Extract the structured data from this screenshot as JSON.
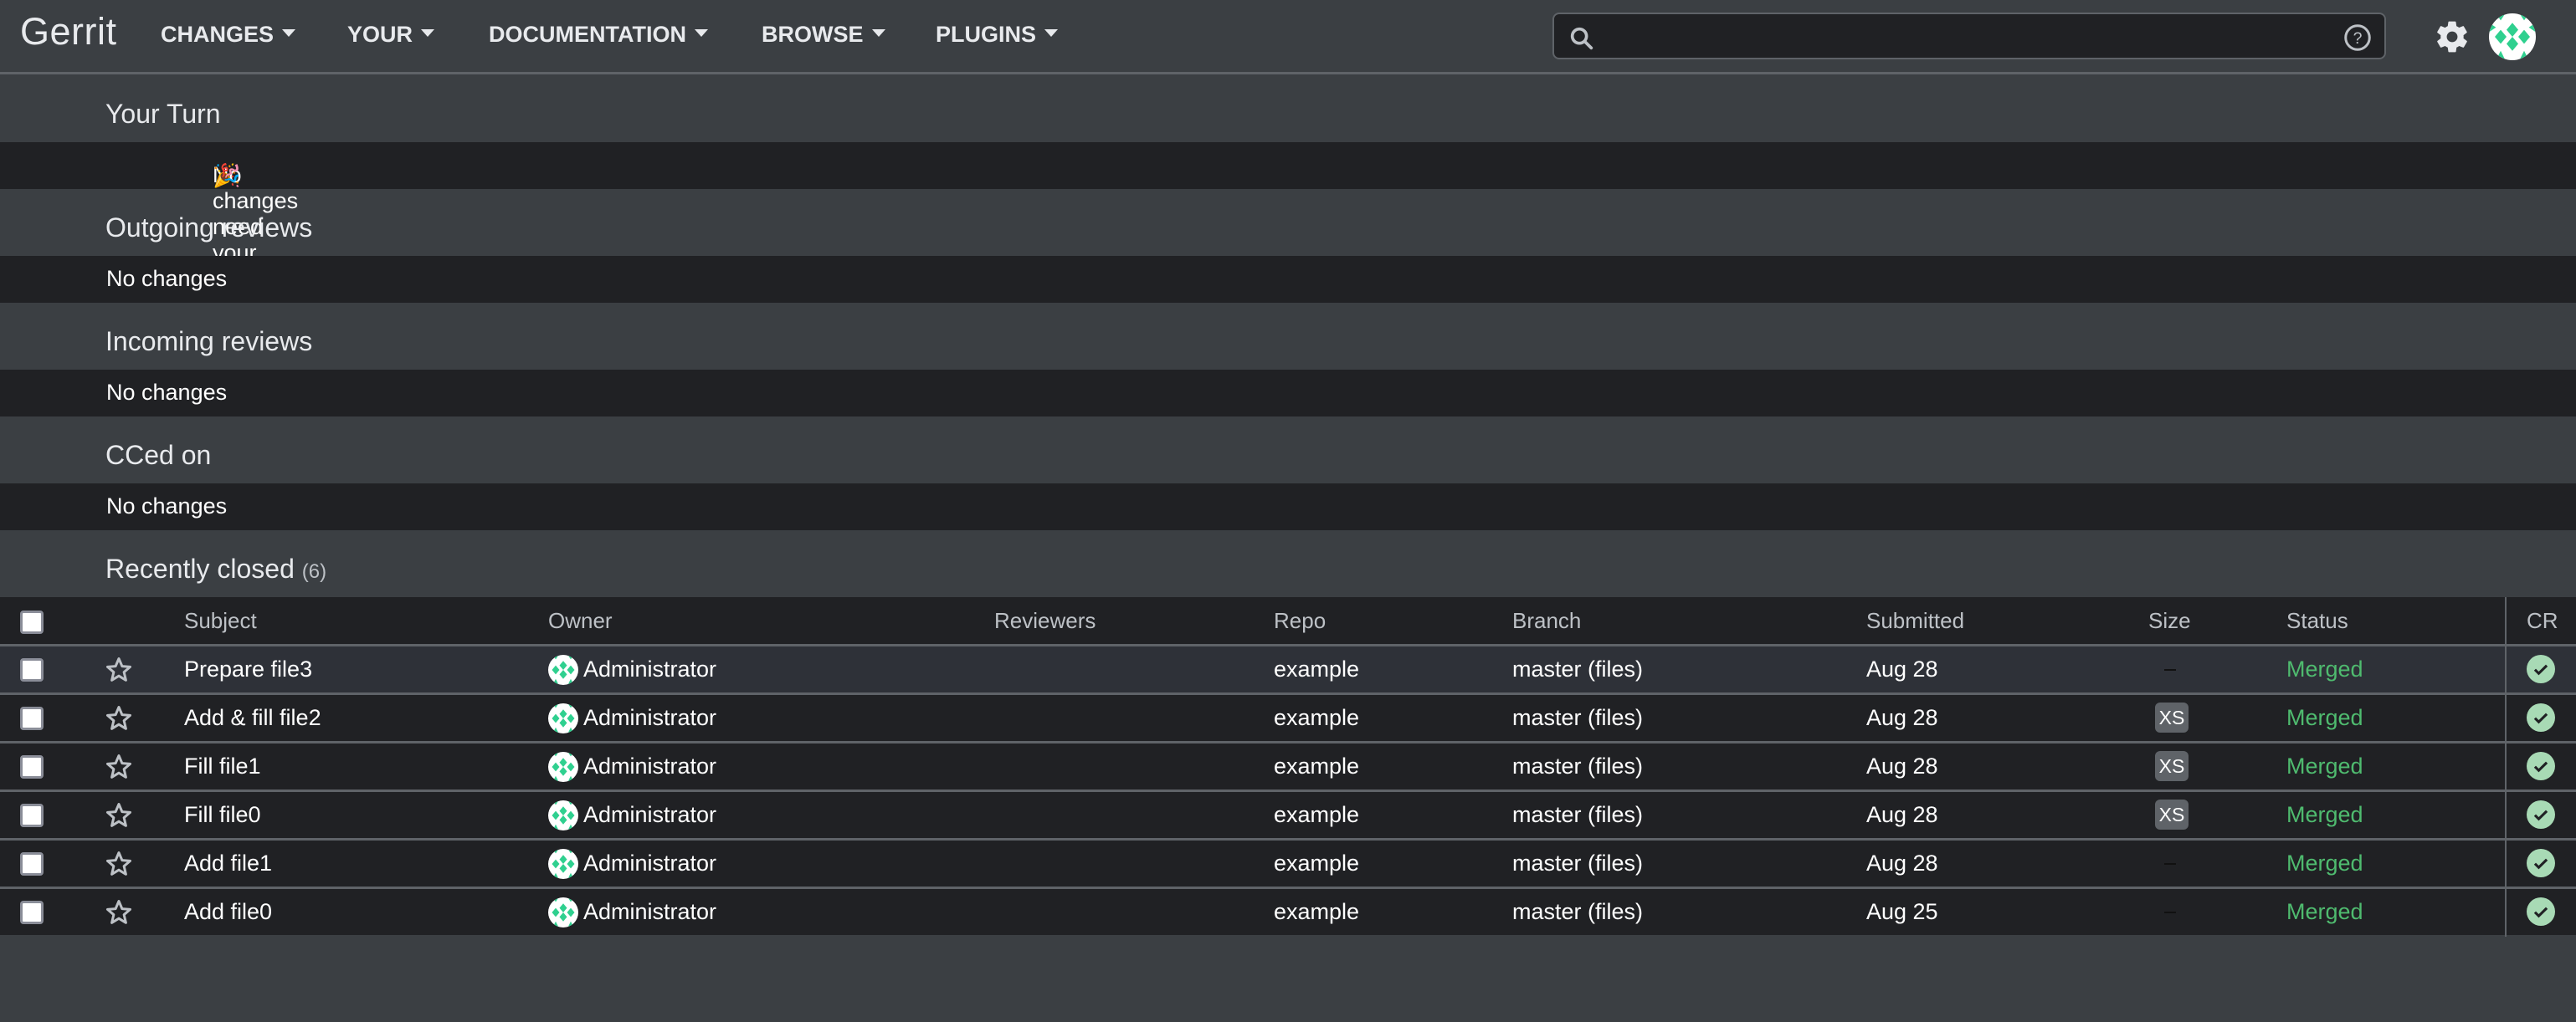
{
  "header": {
    "logo": "Gerrit",
    "nav": [
      {
        "label": "CHANGES"
      },
      {
        "label": "YOUR"
      },
      {
        "label": "DOCUMENTATION"
      },
      {
        "label": "BROWSE"
      },
      {
        "label": "PLUGINS"
      }
    ],
    "search": {
      "value": "",
      "placeholder": ""
    },
    "icons": {
      "search": "search-icon",
      "help": "help-icon",
      "settings": "gear-icon",
      "account": "avatar"
    }
  },
  "sections": [
    {
      "title": "Your Turn",
      "empty_text": "No changes need your attention",
      "emoji": "🎉"
    },
    {
      "title": "Outgoing reviews",
      "empty_text": "No changes"
    },
    {
      "title": "Incoming reviews",
      "empty_text": "No changes"
    },
    {
      "title": "CCed on",
      "empty_text": "No changes"
    }
  ],
  "recently_closed": {
    "title": "Recently closed",
    "count": "(6)",
    "columns": [
      "Subject",
      "Owner",
      "Reviewers",
      "Repo",
      "Branch",
      "Submitted",
      "Size",
      "Status",
      "CR"
    ],
    "rows": [
      {
        "subject": "Prepare file3",
        "owner": "Administrator",
        "reviewers": "",
        "repo": "example",
        "branch": "master (files)",
        "submitted": "Aug 28",
        "size": "-",
        "status": "Merged",
        "cr": "approved"
      },
      {
        "subject": "Add & fill file2",
        "owner": "Administrator",
        "reviewers": "",
        "repo": "example",
        "branch": "master (files)",
        "submitted": "Aug 28",
        "size": "XS",
        "status": "Merged",
        "cr": "approved"
      },
      {
        "subject": "Fill file1",
        "owner": "Administrator",
        "reviewers": "",
        "repo": "example",
        "branch": "master (files)",
        "submitted": "Aug 28",
        "size": "XS",
        "status": "Merged",
        "cr": "approved"
      },
      {
        "subject": "Fill file0",
        "owner": "Administrator",
        "reviewers": "",
        "repo": "example",
        "branch": "master (files)",
        "submitted": "Aug 28",
        "size": "XS",
        "status": "Merged",
        "cr": "approved"
      },
      {
        "subject": "Add file1",
        "owner": "Administrator",
        "reviewers": "",
        "repo": "example",
        "branch": "master (files)",
        "submitted": "Aug 28",
        "size": "-",
        "status": "Merged",
        "cr": "approved"
      },
      {
        "subject": "Add file0",
        "owner": "Administrator",
        "reviewers": "",
        "repo": "example",
        "branch": "master (files)",
        "submitted": "Aug 25",
        "size": "-",
        "status": "Merged",
        "cr": "approved"
      }
    ]
  },
  "colors": {
    "background": "#3b3f43",
    "band": "#202124",
    "merged": "#4fbb6f",
    "cr_approved": "#a8dab5",
    "avatar_accent": "#2fd08f"
  }
}
